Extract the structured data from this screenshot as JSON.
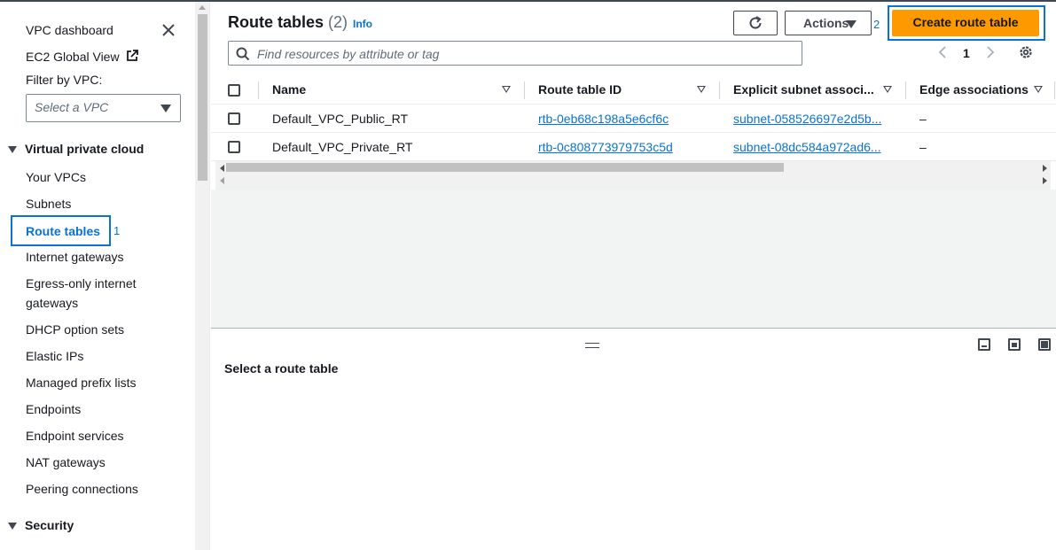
{
  "sidebar": {
    "vpc_dashboard": "VPC dashboard",
    "ec2_global_view": "EC2 Global View",
    "filter_label": "Filter by VPC:",
    "filter_placeholder": "Select a VPC",
    "section_vpc": "Virtual private cloud",
    "items": [
      {
        "label": "Your VPCs"
      },
      {
        "label": "Subnets"
      },
      {
        "label": "Route tables"
      },
      {
        "label": "Internet gateways"
      },
      {
        "label": "Egress-only internet"
      },
      {
        "label": "gateways"
      },
      {
        "label": "DHCP option sets"
      },
      {
        "label": "Elastic IPs"
      },
      {
        "label": "Managed prefix lists"
      },
      {
        "label": "Endpoints"
      },
      {
        "label": "Endpoint services"
      },
      {
        "label": "NAT gateways"
      },
      {
        "label": "Peering connections"
      }
    ],
    "section_security": "Security",
    "annotation": "1"
  },
  "header": {
    "title": "Route tables",
    "count": "(2)",
    "info": "Info",
    "actions_label": "Actions",
    "actions_annotation": "2",
    "create_label": "Create route table",
    "search_placeholder": "Find resources by attribute or tag",
    "page_number": "1"
  },
  "table": {
    "columns": [
      "Name",
      "Route table ID",
      "Explicit subnet associ...",
      "Edge associations"
    ],
    "rows": [
      {
        "name": "Default_VPC_Public_RT",
        "id": "rtb-0eb68c198a5e6cf6c",
        "subnet": "subnet-058526697e2d5b...",
        "edge": "–"
      },
      {
        "name": "Default_VPC_Private_RT",
        "id": "rtb-0c808773979753c5d",
        "subnet": "subnet-08dc584a972ad6...",
        "edge": "–"
      }
    ]
  },
  "lower_panel": {
    "title": "Select a route table"
  },
  "colors": {
    "accent": "#0972d3",
    "primary_button": "#ff9900",
    "text": "#16191f"
  }
}
